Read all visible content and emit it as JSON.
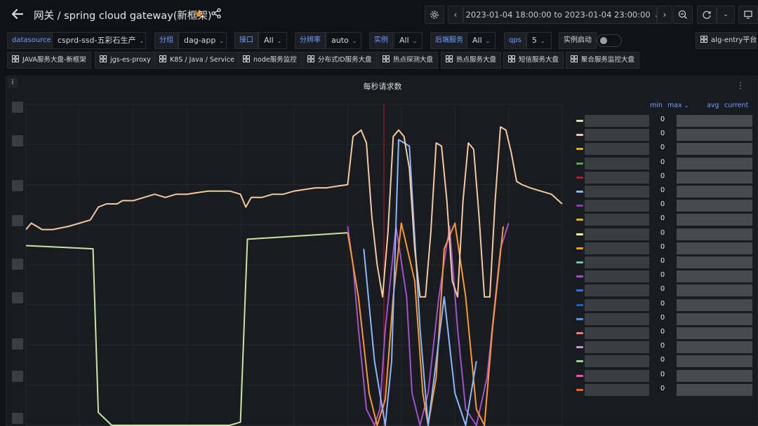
{
  "header": {
    "title": "网关 / spring cloud gateway(新框架)",
    "time_range": "2023-01-04 18:00:00 to 2023-01-04 23:00:00"
  },
  "variables": [
    {
      "label": "datasource",
      "value": "csprd-ssd-五彩石生产"
    },
    {
      "label": "分组",
      "value": "dag-app"
    },
    {
      "label": "接口",
      "value": "All"
    },
    {
      "label": "分辨率",
      "value": "auto"
    },
    {
      "label": "实例",
      "value": "All"
    },
    {
      "label": "后端服务",
      "value": "All"
    },
    {
      "label": "qps",
      "value": "5"
    },
    {
      "label": "实例启动",
      "value": ""
    }
  ],
  "right_link": "alg-entry平台",
  "links": [
    "JAVA服务大盘-新框架",
    "jgs-es-proxy",
    "K8S / Java / Service",
    "node服务监控",
    "分布式ID服务大盘",
    "热点探测大盘",
    "热点服务大盘",
    "短信服务大盘",
    "聚合服务监控大盘"
  ],
  "panel": {
    "info": "i",
    "title": "每秒请求数",
    "menu": "⋮"
  },
  "legend": {
    "headers": {
      "min": "min",
      "max": "max",
      "avg": "avg",
      "current": "current"
    },
    "rows": [
      {
        "color": "#c8e6a0",
        "min": "0"
      },
      {
        "color": "#f2c9a0",
        "min": "0"
      },
      {
        "color": "#e0b400",
        "min": "0"
      },
      {
        "color": "#56a64b",
        "min": "0"
      },
      {
        "color": "#c4162a",
        "min": "0"
      },
      {
        "color": "#8ab8ff",
        "min": "0"
      },
      {
        "color": "#8f3bb8",
        "min": "0"
      },
      {
        "color": "#e0b400",
        "min": "0"
      },
      {
        "color": "#fff899",
        "min": "0"
      },
      {
        "color": "#ff9830",
        "min": "0"
      },
      {
        "color": "#73bfb8",
        "min": "0"
      },
      {
        "color": "#a352cc",
        "min": "0"
      },
      {
        "color": "#3274d9",
        "min": "0"
      },
      {
        "color": "#1f60c4",
        "min": "0"
      },
      {
        "color": "#5794f2",
        "min": "0"
      },
      {
        "color": "#ff7383",
        "min": "0"
      },
      {
        "color": "#ca95e5",
        "min": "0"
      },
      {
        "color": "#96d98d",
        "min": "0"
      },
      {
        "color": "#ff4ec6",
        "min": "0"
      },
      {
        "color": "#fa6400",
        "min": "0"
      }
    ]
  },
  "chart_data": {
    "type": "line",
    "ylim": [
      0,
      100
    ],
    "xlim": [
      0,
      100
    ],
    "series": [
      {
        "color": "#c8e6a0",
        "x": [
          0,
          12.5,
          13.5,
          16,
          25,
          38,
          40,
          41.3,
          60
        ],
        "y": [
          56,
          55,
          4,
          0,
          0,
          0,
          1,
          58,
          60
        ]
      },
      {
        "color": "#a352cc",
        "x": [
          60,
          61,
          62,
          63.5,
          65,
          66,
          67,
          69,
          71,
          72,
          73.5,
          75,
          77,
          79,
          80.5,
          82,
          84,
          86,
          88.5,
          90
        ],
        "y": [
          62,
          50,
          30,
          5,
          0,
          5,
          30,
          62,
          40,
          10,
          0,
          10,
          40,
          62,
          30,
          5,
          0,
          15,
          55,
          63
        ]
      },
      {
        "color": "#ff9830",
        "x": [
          60,
          62,
          64,
          65.5,
          67,
          68.5,
          70,
          72.5,
          74,
          75,
          76.5,
          78,
          80,
          82,
          84,
          85.5,
          87,
          89
        ],
        "y": [
          60,
          40,
          10,
          0,
          8,
          40,
          63,
          45,
          10,
          0,
          15,
          55,
          63,
          40,
          5,
          0,
          30,
          62
        ]
      },
      {
        "color": "#8ab8ff",
        "x": [
          63,
          65,
          67,
          68.2,
          69.5,
          71.5,
          73.5,
          75,
          76.5,
          78,
          80,
          82,
          84
        ],
        "y": [
          55,
          20,
          0,
          20,
          89,
          87,
          30,
          0,
          20,
          40,
          10,
          0,
          20
        ]
      },
      {
        "color": "#f2c9a0",
        "x": [
          0,
          1,
          2,
          3,
          5,
          8,
          10,
          12,
          13.5,
          15,
          17,
          18,
          20,
          22,
          24,
          26,
          28,
          30,
          32,
          34,
          36,
          38,
          40,
          41,
          42,
          44,
          46,
          48,
          50,
          52,
          54,
          56,
          58,
          60,
          61,
          62.5,
          63.5,
          64.5,
          65.5,
          66.5,
          67.5,
          68.5,
          69.5,
          70.5,
          71.5,
          72.5,
          73.5,
          74.5,
          75.5,
          76.5,
          77.5,
          78.5,
          79.5,
          80.5,
          81.5,
          82.5,
          83.5,
          84.5,
          85.5,
          86.5,
          87.5,
          88.5,
          89.5,
          90.5,
          91.5,
          92.5,
          94,
          96,
          98,
          100
        ],
        "y": [
          61,
          63,
          62,
          61,
          61,
          62,
          63,
          64,
          68,
          69,
          69,
          70,
          70,
          71,
          72,
          71,
          72,
          72,
          72.5,
          73,
          73,
          73,
          72,
          68,
          71,
          71,
          72,
          72,
          73,
          73.5,
          74,
          74,
          74.5,
          75,
          90,
          92,
          88,
          65,
          50,
          40,
          60,
          90,
          92,
          90,
          80,
          55,
          40,
          40,
          60,
          88,
          87,
          70,
          45,
          40,
          70,
          88,
          86,
          65,
          40,
          40,
          70,
          93,
          92,
          85,
          76,
          75,
          74,
          73,
          72,
          69
        ]
      }
    ]
  }
}
